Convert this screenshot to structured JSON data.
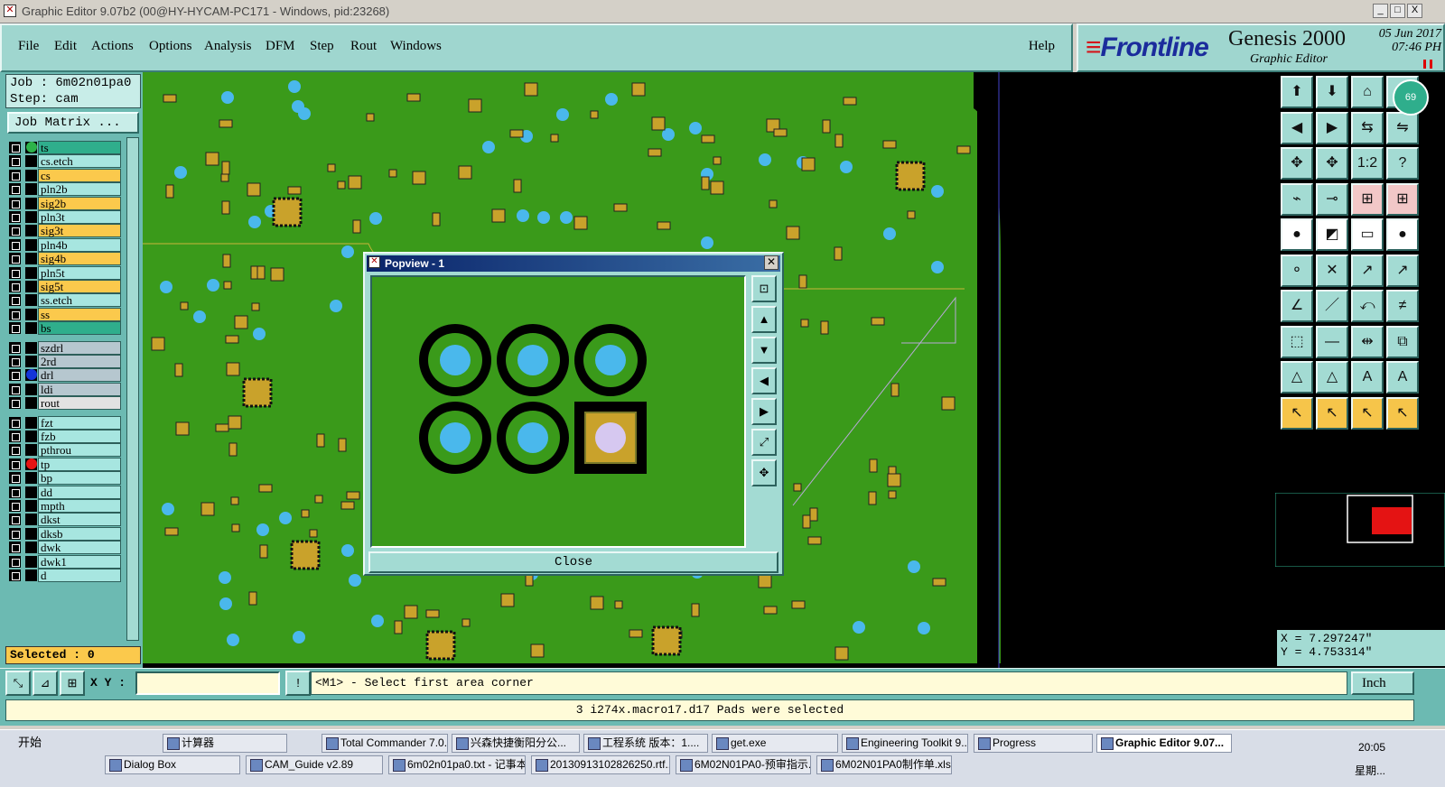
{
  "window": {
    "title": "Graphic Editor 9.07b2 (00@HY-HYCAM-PC171 - Windows, pid:23268)",
    "min": "_",
    "max": "□",
    "close": "X"
  },
  "menu": [
    "File",
    "Edit",
    "Actions",
    "Options",
    "Analysis",
    "DFM",
    "Step",
    "Rout",
    "Windows"
  ],
  "help": "Help",
  "brand": {
    "logo": "Frontline",
    "product": "Genesis 2000",
    "subtitle": "Graphic Editor",
    "date": "05 Jun 2017",
    "time": "07:46 PH"
  },
  "job": {
    "job": "Job : 6m02n01pa0",
    "step": "Step: cam",
    "matrix": "Job Matrix ..."
  },
  "layers": [
    {
      "name": "ts",
      "color": "#2fae8c",
      "dot": "#2db34a"
    },
    {
      "name": "cs.etch",
      "color": "#a7e6e0"
    },
    {
      "name": "cs",
      "color": "#fbc94c"
    },
    {
      "name": "pln2b",
      "color": "#a7e6e0"
    },
    {
      "name": "sig2b",
      "color": "#fbc94c"
    },
    {
      "name": "pln3t",
      "color": "#a7e6e0"
    },
    {
      "name": "sig3t",
      "color": "#fbc94c"
    },
    {
      "name": "pln4b",
      "color": "#a7e6e0"
    },
    {
      "name": "sig4b",
      "color": "#fbc94c"
    },
    {
      "name": "pln5t",
      "color": "#a7e6e0"
    },
    {
      "name": "sig5t",
      "color": "#fbc94c"
    },
    {
      "name": "ss.etch",
      "color": "#a7e6e0"
    },
    {
      "name": "ss",
      "color": "#fbc94c"
    },
    {
      "name": "bs",
      "color": "#2fae8c"
    },
    {
      "name": "szdrl",
      "color": "#b6c7cf"
    },
    {
      "name": "2rd",
      "color": "#b6c7cf"
    },
    {
      "name": "drl",
      "color": "#b6c7cf",
      "dot": "#1535d8"
    },
    {
      "name": "ldi",
      "color": "#b6c7cf"
    },
    {
      "name": "rout",
      "color": "#e2e2e2"
    },
    {
      "name": "fzt",
      "color": "#a7e6e0"
    },
    {
      "name": "fzb",
      "color": "#a7e6e0"
    },
    {
      "name": "pthrou",
      "color": "#a7e6e0"
    },
    {
      "name": "tp",
      "color": "#a7e6e0",
      "dot": "#e41313"
    },
    {
      "name": "bp",
      "color": "#a7e6e0"
    },
    {
      "name": "dd",
      "color": "#a7e6e0"
    },
    {
      "name": "mpth",
      "color": "#a7e6e0"
    },
    {
      "name": "dkst",
      "color": "#a7e6e0"
    },
    {
      "name": "dksb",
      "color": "#a7e6e0"
    },
    {
      "name": "dwk",
      "color": "#a7e6e0"
    },
    {
      "name": "dwk1",
      "color": "#a7e6e0"
    },
    {
      "name": "d",
      "color": "#a7e6e0"
    }
  ],
  "selected": "Selected : 0",
  "coords": {
    "x": "X = 7.297247\"",
    "y": "Y = 4.753314\""
  },
  "xy_label": "X Y :",
  "xy_value": "",
  "prompt": "<M1> - Select first area corner",
  "unit": "Inch",
  "status": "3 i274x.macro17.d17 Pads were selected",
  "popup": {
    "title": "Popview - 1",
    "close": "Close"
  },
  "badge": "69",
  "taskbar": {
    "start": "开始",
    "row1": [
      "计算器",
      "Total Commander 7.0...",
      "兴森快捷衡阳分公...",
      "工程系统  版本：1....",
      "get.exe",
      "Engineering Toolkit 9....",
      "Progress",
      "Graphic Editor 9.07..."
    ],
    "row2": [
      "Dialog Box",
      "CAM_Guide v2.89",
      "6m02n01pa0.txt - 记事本",
      "20130913102826250.rtf...",
      "6M02N01PA0-预审指示....",
      "6M02N01PA0制作单.xls ..."
    ],
    "clock": "20:05",
    "weekday": "星期..."
  }
}
